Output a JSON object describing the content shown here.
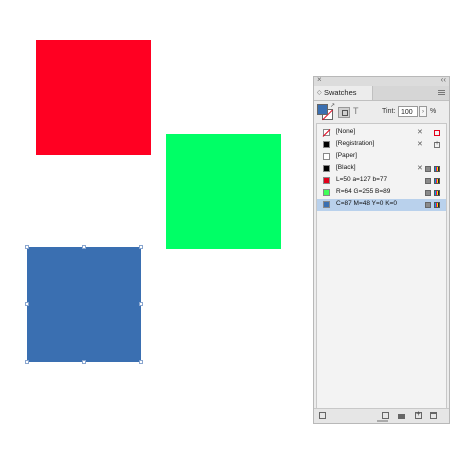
{
  "canvas": {
    "shapes": [
      {
        "name": "red-square",
        "color": "#ff0022"
      },
      {
        "name": "green-square",
        "color": "#00ff66"
      },
      {
        "name": "blue-square",
        "color": "#3a6fb1",
        "selected": true
      }
    ]
  },
  "panel": {
    "title": "Swatches",
    "tint_label": "Tint:",
    "tint_value": "100",
    "tint_unit": "%",
    "text_icon": "T",
    "fill_color": "#3a6fb1",
    "swatches": [
      {
        "label": "[None]",
        "color": null
      },
      {
        "label": "[Registration]",
        "color": "#000000"
      },
      {
        "label": "[Paper]",
        "color": "#ffffff"
      },
      {
        "label": "[Black]",
        "color": "#000000"
      },
      {
        "label": "L=50 a=127 b=77",
        "color": "#e2001a"
      },
      {
        "label": "R=64 G=255 B=89",
        "color": "#40ff59"
      },
      {
        "label": "C=87 M=48 Y=0 K=0",
        "color": "#3a6fb1",
        "selected": true
      }
    ]
  }
}
